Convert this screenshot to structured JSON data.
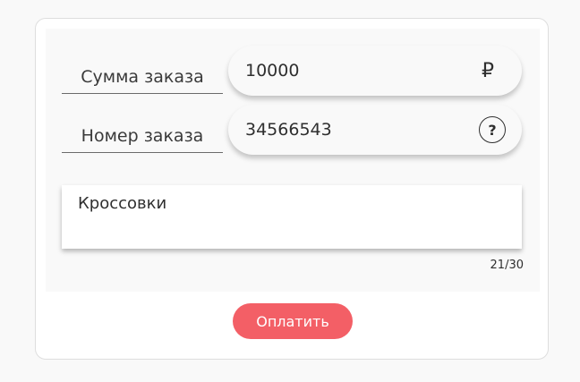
{
  "form": {
    "amount": {
      "label": "Сумма заказа",
      "value": "10000",
      "currency_symbol": "₽"
    },
    "order_number": {
      "label": "Номер заказа",
      "value": "34566543",
      "help_symbol": "?"
    },
    "description": {
      "value": "Кроссовки",
      "counter": "21/30"
    },
    "pay_button_label": "Оплатить"
  },
  "colors": {
    "accent": "#f35f66",
    "text": "#2f2f2f",
    "card_background": "#ffffff",
    "page_background": "#f9f9f9"
  }
}
